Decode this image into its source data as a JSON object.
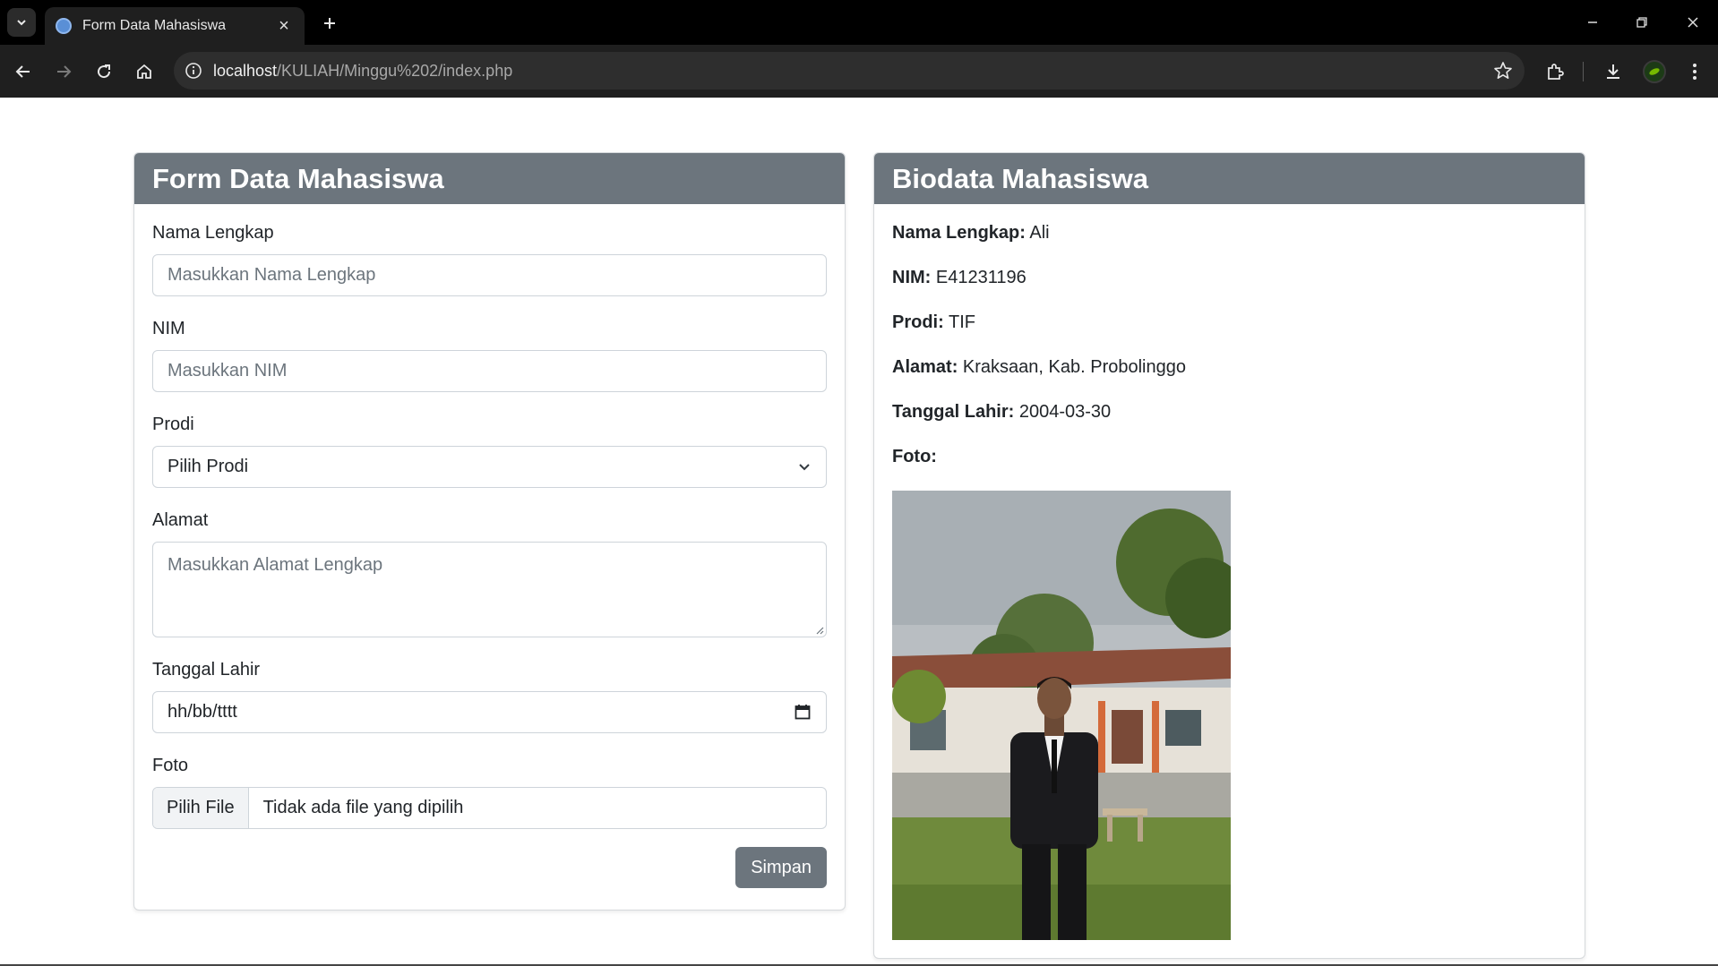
{
  "browser": {
    "tab_title": "Form Data Mahasiswa",
    "url_host": "localhost",
    "url_path": "/KULIAH/Minggu%202/index.php"
  },
  "form": {
    "title": "Form Data Mahasiswa",
    "nama_label": "Nama Lengkap",
    "nama_placeholder": "Masukkan Nama Lengkap",
    "nim_label": "NIM",
    "nim_placeholder": "Masukkan NIM",
    "prodi_label": "Prodi",
    "prodi_selected": "Pilih Prodi",
    "alamat_label": "Alamat",
    "alamat_placeholder": "Masukkan Alamat Lengkap",
    "tanggal_label": "Tanggal Lahir",
    "tanggal_value": "hh/bb/tttt",
    "foto_label": "Foto",
    "file_button": "Pilih File",
    "file_status": "Tidak ada file yang dipilih",
    "submit_label": "Simpan"
  },
  "biodata": {
    "title": "Biodata Mahasiswa",
    "rows": [
      {
        "key": "Nama Lengkap:",
        "value": "Ali"
      },
      {
        "key": "NIM:",
        "value": "E41231196"
      },
      {
        "key": "Prodi:",
        "value": "TIF"
      },
      {
        "key": "Alamat:",
        "value": "Kraksaan, Kab. Probolinggo"
      },
      {
        "key": "Tanggal Lahir:",
        "value": "2004-03-30"
      },
      {
        "key": "Foto:",
        "value": ""
      }
    ]
  },
  "colors": {
    "card_header": "#6c757d",
    "button": "#6c757d",
    "chrome_dark": "#1f1f1f"
  },
  "icons": [
    "back-icon",
    "forward-icon",
    "reload-icon",
    "home-icon",
    "info-icon",
    "star-icon",
    "extensions-icon",
    "download-icon",
    "profile-icon",
    "menu-icon",
    "chevron-down-icon",
    "calendar-icon"
  ]
}
